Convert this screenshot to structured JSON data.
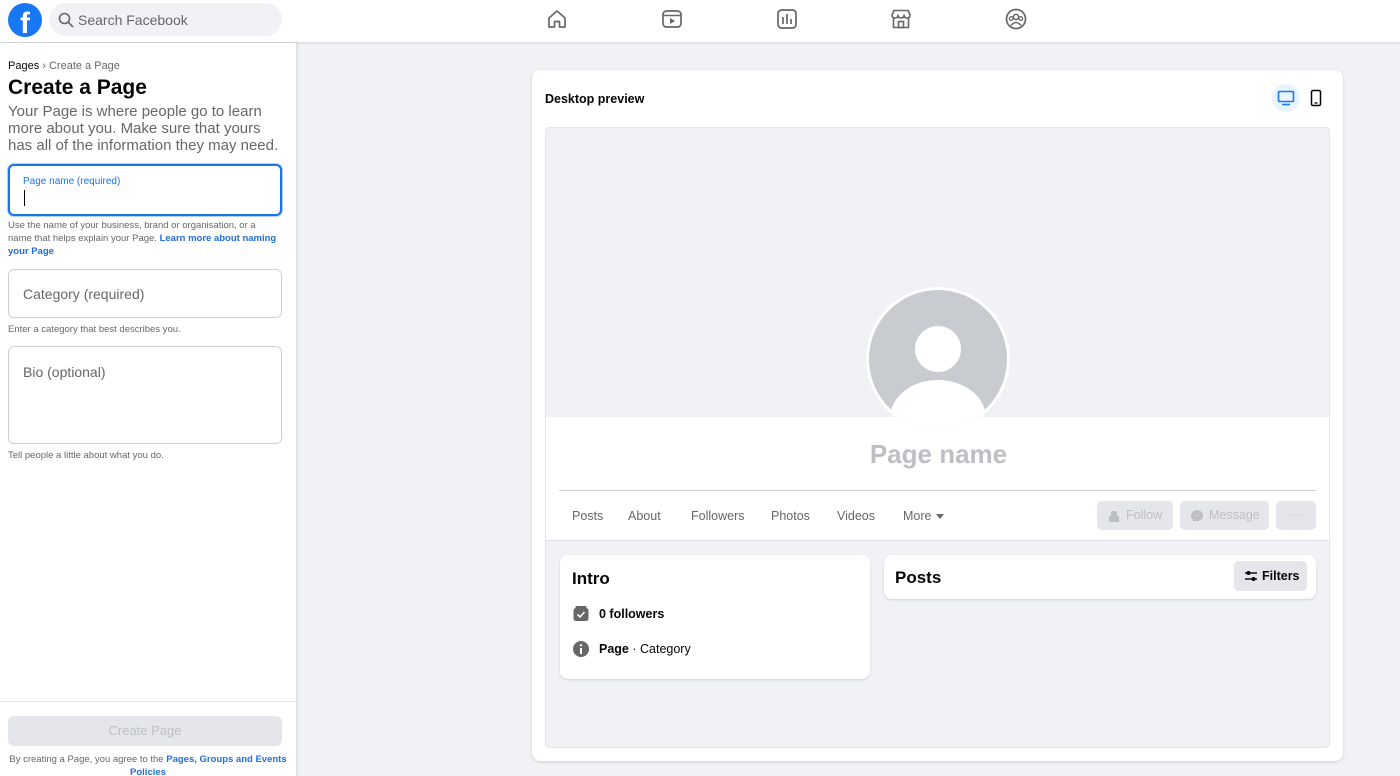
{
  "topbar": {
    "logo": "f",
    "search_placeholder": "Search Facebook",
    "nav_icons": [
      "home-icon",
      "video-icon",
      "pages-icon",
      "marketplace-icon",
      "groups-icon"
    ]
  },
  "left": {
    "breadcrumb_root": "Pages",
    "breadcrumb_sep": " › ",
    "breadcrumb_current": "Create a Page",
    "title": "Create a Page",
    "description": "Your Page is where people go to learn more about you. Make sure that yours has all of the information they may need.",
    "name_field_label": "Page name (required)",
    "name_helper": "Use the name of your business, brand or organisation, or a name that helps explain your Page.",
    "name_helper_link": "Learn more about naming your Page",
    "category_placeholder": "Category (required)",
    "category_helper": "Enter a category that best describes you.",
    "bio_placeholder": "Bio (optional)",
    "bio_helper": "Tell people a little about what you do.",
    "create_button": "Create Page",
    "terms_text": "By creating a Page, you agree to the",
    "terms_link": "Pages, Groups and Events Policies"
  },
  "preview": {
    "title": "Desktop preview",
    "page_name": "Page name",
    "tabs": [
      "Posts",
      "About",
      "Followers",
      "Photos",
      "Videos",
      "More"
    ],
    "follow_button": "Follow",
    "message_button": "Message",
    "more_button": "···",
    "intro_title": "Intro",
    "followers_text": "0 followers",
    "page_label": "Page",
    "category_text": " · Category",
    "posts_title": "Posts",
    "filters_button": "Filters"
  },
  "colors": {
    "brand": "#1877f2",
    "link": "#216fdb",
    "disabled_text": "#bcc0c4"
  }
}
